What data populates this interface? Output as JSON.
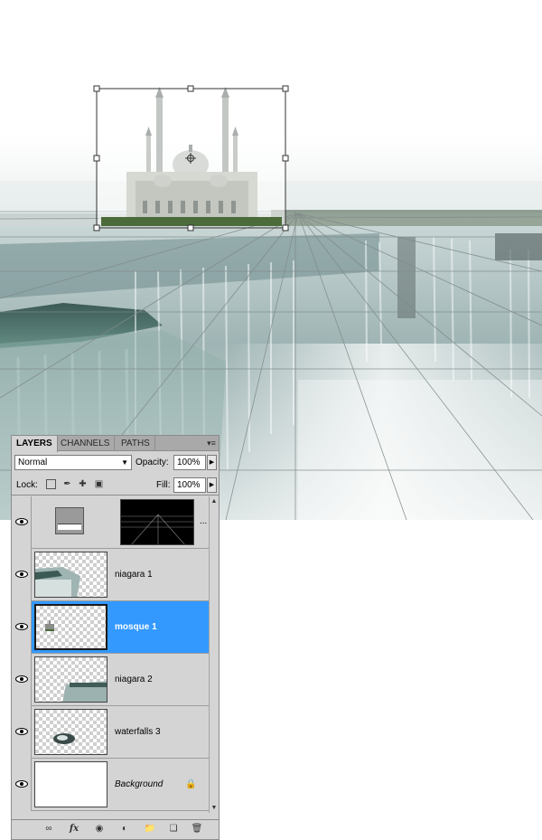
{
  "panel": {
    "tabs": [
      {
        "label": "LAYERS",
        "active": true
      },
      {
        "label": "CHANNELS",
        "active": false
      },
      {
        "label": "PATHS",
        "active": false
      }
    ],
    "blend_mode": "Normal",
    "opacity_label": "Opacity:",
    "opacity_value": "100%",
    "lock_label": "Lock:",
    "fill_label": "Fill:",
    "fill_value": "100%",
    "layers": [
      {
        "name": "",
        "kind": "adjustment",
        "visible": true,
        "selected": false
      },
      {
        "name": "niagara 1",
        "kind": "pixel",
        "visible": true,
        "selected": false
      },
      {
        "name": "mosque 1",
        "kind": "pixel",
        "visible": true,
        "selected": true
      },
      {
        "name": "niagara 2",
        "kind": "pixel",
        "visible": true,
        "selected": false
      },
      {
        "name": "waterfalls 3",
        "kind": "pixel",
        "visible": true,
        "selected": false
      },
      {
        "name": "Background",
        "kind": "background",
        "visible": true,
        "selected": false,
        "locked": true
      }
    ],
    "adjustment_more": "..."
  },
  "colors": {
    "selection": "#3399ff",
    "panel_bg": "#d4d4d4",
    "tab_bg": "#a9a9a9"
  },
  "icons": {
    "footer": [
      "link-layers-icon",
      "fx-icon",
      "add-mask-icon",
      "adjustment-layer-icon",
      "new-group-icon",
      "new-layer-icon",
      "delete-layer-icon"
    ]
  }
}
